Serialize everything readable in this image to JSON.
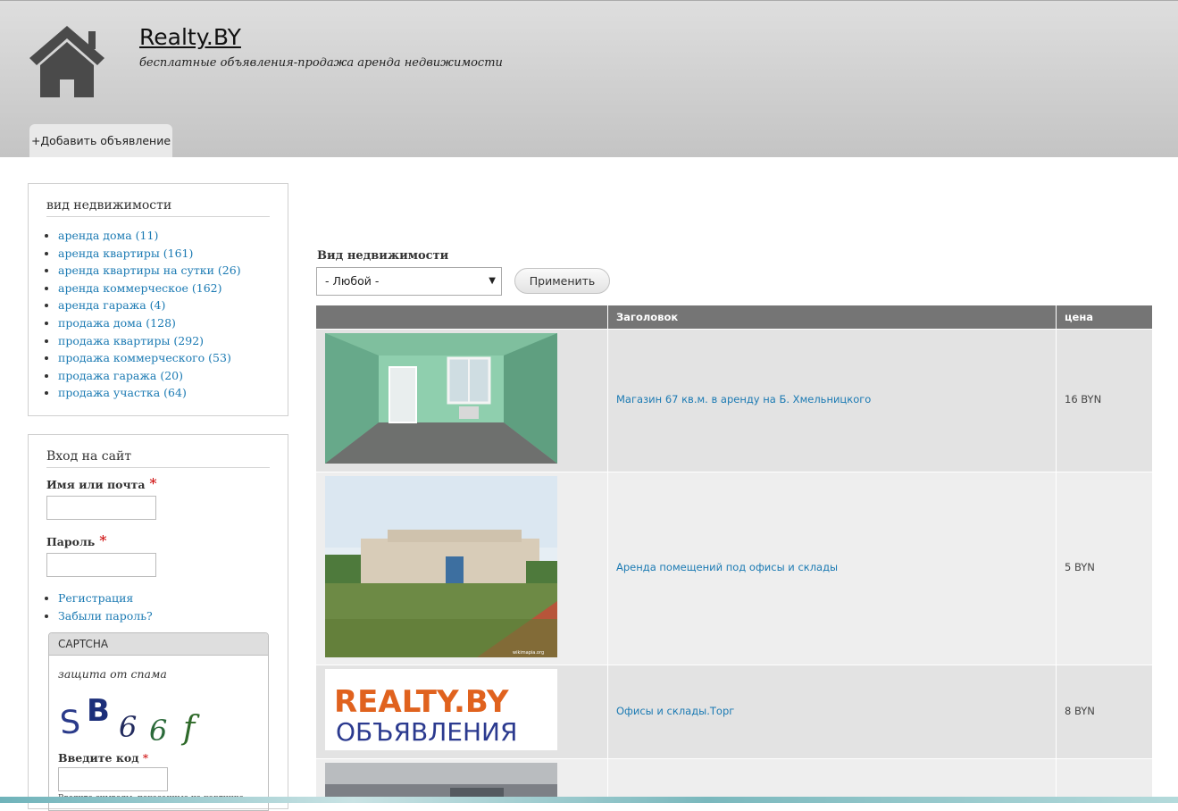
{
  "header": {
    "site_name": "Realty.BY",
    "slogan": "бесплатные объявления-продажа аренда недвижимости",
    "add_tab": "+Добавить объявление"
  },
  "sidebar": {
    "categories": {
      "title": "вид недвижимости",
      "items": [
        {
          "label": "аренда дома (11)"
        },
        {
          "label": "аренда квартиры (161)"
        },
        {
          "label": "аренда квартиры на сутки (26)"
        },
        {
          "label": "аренда коммерческое (162)"
        },
        {
          "label": "аренда гаража (4)"
        },
        {
          "label": "продажа дома (128)"
        },
        {
          "label": "продажа квартиры (292)"
        },
        {
          "label": "продажа коммерческого (53)"
        },
        {
          "label": "продажа гаража (20)"
        },
        {
          "label": "продажа участка (64)"
        }
      ]
    },
    "login": {
      "title": "Вход на сайт",
      "username_label": "Имя или почта",
      "password_label": "Пароль",
      "required_mark": "*",
      "links": [
        {
          "label": "Регистрация"
        },
        {
          "label": "Забыли пароль?"
        }
      ],
      "captcha": {
        "header": "CAPTCHA",
        "description": "защита от спама",
        "code_chars": [
          "S",
          "B",
          "6",
          "6",
          "f"
        ],
        "code_label": "Введите код",
        "help": "Введите символы, показанные на картинке."
      }
    }
  },
  "filter": {
    "label": "Вид недвижимости",
    "selected": "- Любой -",
    "apply": "Применить"
  },
  "table": {
    "columns": [
      "",
      "Заголовок",
      "цена"
    ],
    "rows": [
      {
        "title": "Магазин 67 кв.м. в аренду на Б. Хмельницкого",
        "price": "16 BYN",
        "image": "empty-green-room-photo"
      },
      {
        "title": "Аренда помещений под офисы и склады",
        "price": "5 BYN",
        "image": "office-building-photo",
        "watermark": "wikimapia.org"
      },
      {
        "title": "Офисы и склады.Торг",
        "price": "8 BYN",
        "image": "realty-by-logo",
        "logo_line1": "REALTY.BY",
        "logo_line2": "ОБЪЯВЛЕНИЯ"
      },
      {
        "title": "",
        "price": "",
        "image": "building-photo"
      }
    ]
  },
  "colors": {
    "link": "#1b7ab3",
    "table_header": "#757575",
    "required": "#cc0000"
  }
}
